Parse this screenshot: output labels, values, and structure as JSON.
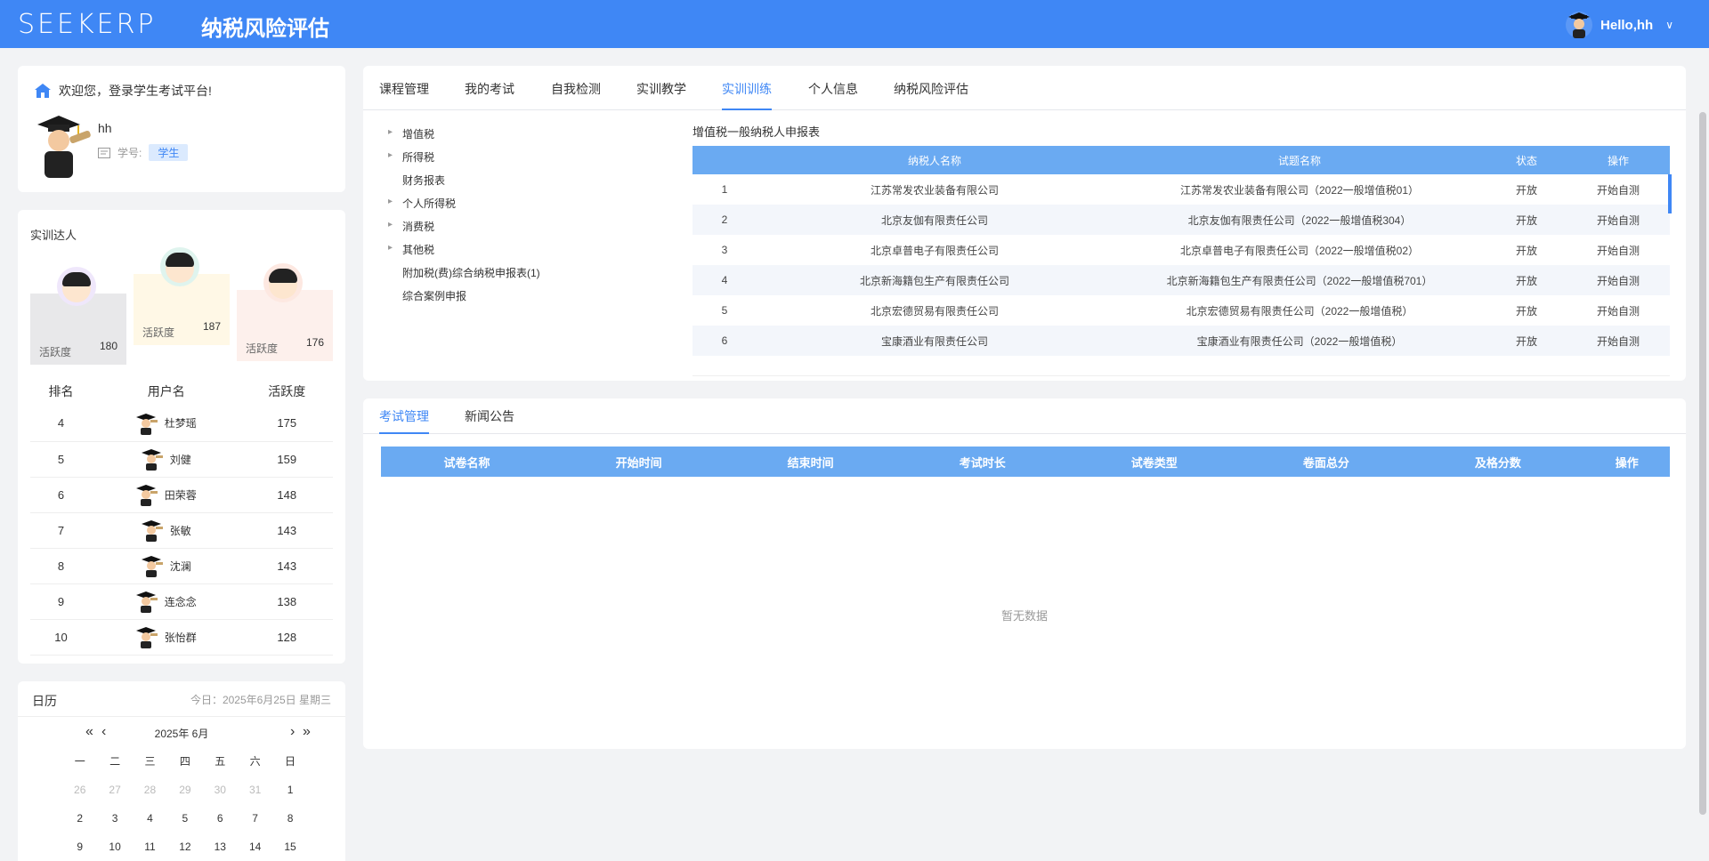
{
  "header": {
    "logo": "SEEKERP",
    "title": "纳税风险评估",
    "user": "Hello,hh"
  },
  "welcome": {
    "greeting": "欢迎您，登录学生考试平台!",
    "name": "hh",
    "id_label": "学号:",
    "role": "学生"
  },
  "ranking": {
    "title": "实训达人",
    "podium": [
      {
        "label": "活跃度",
        "value": "180",
        "color": "#e8e8ea"
      },
      {
        "label": "活跃度",
        "value": "187",
        "color": "#fff8e6"
      },
      {
        "label": "活跃度",
        "value": "176",
        "color": "#fdf0ec"
      }
    ],
    "columns": [
      "排名",
      "用户名",
      "活跃度"
    ],
    "rows": [
      {
        "rank": "4",
        "user": "杜梦瑶",
        "score": "175"
      },
      {
        "rank": "5",
        "user": "刘健",
        "score": "159"
      },
      {
        "rank": "6",
        "user": "田荣蓉",
        "score": "148"
      },
      {
        "rank": "7",
        "user": "张敏",
        "score": "143"
      },
      {
        "rank": "8",
        "user": "沈澜",
        "score": "143"
      },
      {
        "rank": "9",
        "user": "连念念",
        "score": "138"
      },
      {
        "rank": "10",
        "user": "张怡群",
        "score": "128"
      }
    ]
  },
  "calendar": {
    "title": "日历",
    "today": "今日：2025年6月25日 星期三",
    "month": "2025年  6月",
    "prev_year": "«",
    "prev_month": "‹",
    "next_month": "›",
    "next_year": "»",
    "weekdays": [
      "一",
      "二",
      "三",
      "四",
      "五",
      "六",
      "日"
    ],
    "days": [
      {
        "d": "26",
        "dim": true
      },
      {
        "d": "27",
        "dim": true
      },
      {
        "d": "28",
        "dim": true
      },
      {
        "d": "29",
        "dim": true
      },
      {
        "d": "30",
        "dim": true
      },
      {
        "d": "31",
        "dim": true
      },
      {
        "d": "1",
        "dim": false
      },
      {
        "d": "2",
        "dim": false
      },
      {
        "d": "3",
        "dim": false
      },
      {
        "d": "4",
        "dim": false
      },
      {
        "d": "5",
        "dim": false
      },
      {
        "d": "6",
        "dim": false
      },
      {
        "d": "7",
        "dim": false
      },
      {
        "d": "8",
        "dim": false
      },
      {
        "d": "9",
        "dim": false
      },
      {
        "d": "10",
        "dim": false
      },
      {
        "d": "11",
        "dim": false
      },
      {
        "d": "12",
        "dim": false
      },
      {
        "d": "13",
        "dim": false
      },
      {
        "d": "14",
        "dim": false
      },
      {
        "d": "15",
        "dim": false
      }
    ]
  },
  "tabs": [
    "课程管理",
    "我的考试",
    "自我检测",
    "实训教学",
    "实训训练",
    "个人信息",
    "纳税风险评估"
  ],
  "active_tab": 4,
  "tree": [
    {
      "label": "增值税",
      "arrow": true
    },
    {
      "label": "所得税",
      "arrow": true
    },
    {
      "label": "财务报表",
      "arrow": false
    },
    {
      "label": "个人所得税",
      "arrow": true
    },
    {
      "label": "消费税",
      "arrow": true
    },
    {
      "label": "其他税",
      "arrow": true
    },
    {
      "label": "附加税(费)综合纳税申报表(1)",
      "arrow": false
    },
    {
      "label": "综合案例申报",
      "arrow": false
    }
  ],
  "content": {
    "title": "增值税一般纳税人申报表",
    "columns": [
      "",
      "纳税人名称",
      "试题名称",
      "状态",
      "操作"
    ],
    "rows": [
      {
        "no": "1",
        "company": "江苏常发农业装备有限公司",
        "exam": "江苏常发农业装备有限公司（2022一般增值税01）",
        "status": "开放",
        "action": "开始自测"
      },
      {
        "no": "2",
        "company": "北京友伽有限责任公司",
        "exam": "北京友伽有限责任公司（2022一般增值税304）",
        "status": "开放",
        "action": "开始自测"
      },
      {
        "no": "3",
        "company": "北京卓普电子有限责任公司",
        "exam": "北京卓普电子有限责任公司（2022一般增值税02）",
        "status": "开放",
        "action": "开始自测"
      },
      {
        "no": "4",
        "company": "北京新海籍包生产有限责任公司",
        "exam": "北京新海籍包生产有限责任公司（2022一般增值税701）",
        "status": "开放",
        "action": "开始自测"
      },
      {
        "no": "5",
        "company": "北京宏德贸易有限责任公司",
        "exam": "北京宏德贸易有限责任公司（2022一般增值税）",
        "status": "开放",
        "action": "开始自测"
      },
      {
        "no": "6",
        "company": "宝康酒业有限责任公司",
        "exam": "宝康酒业有限责任公司（2022一般增值税）",
        "status": "开放",
        "action": "开始自测"
      }
    ]
  },
  "bottom_tabs": [
    "考试管理",
    "新闻公告"
  ],
  "exam_columns": [
    "试卷名称",
    "开始时间",
    "结束时间",
    "考试时长",
    "试卷类型",
    "卷面总分",
    "及格分数",
    "操作"
  ],
  "empty_text": "暂无数据",
  "colors": {
    "brand": "#3f87f5",
    "table_header": "#6aaaf2"
  }
}
